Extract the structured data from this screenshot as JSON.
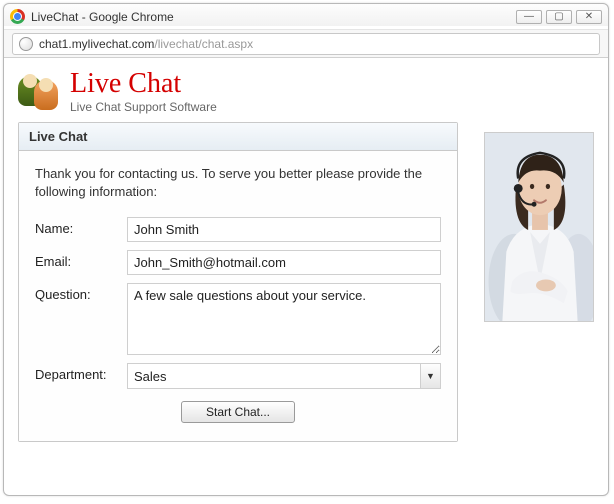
{
  "window": {
    "title": "LiveChat - Google Chrome",
    "min_label": "—",
    "max_label": "▢",
    "close_label": "✕"
  },
  "address": {
    "host": "chat1.mylivechat.com",
    "path": "/livechat/chat.aspx"
  },
  "brand": {
    "title": "Live Chat",
    "subtitle": "Live Chat Support Software"
  },
  "panel": {
    "title": "Live Chat",
    "intro": "Thank you for contacting us. To serve you better please provide the following information:",
    "labels": {
      "name": "Name:",
      "email": "Email:",
      "question": "Question:",
      "department": "Department:"
    },
    "values": {
      "name": "John Smith",
      "email": "John_Smith@hotmail.com",
      "question": "A few sale questions about your service.",
      "department": "Sales"
    },
    "start_button": "Start Chat..."
  }
}
